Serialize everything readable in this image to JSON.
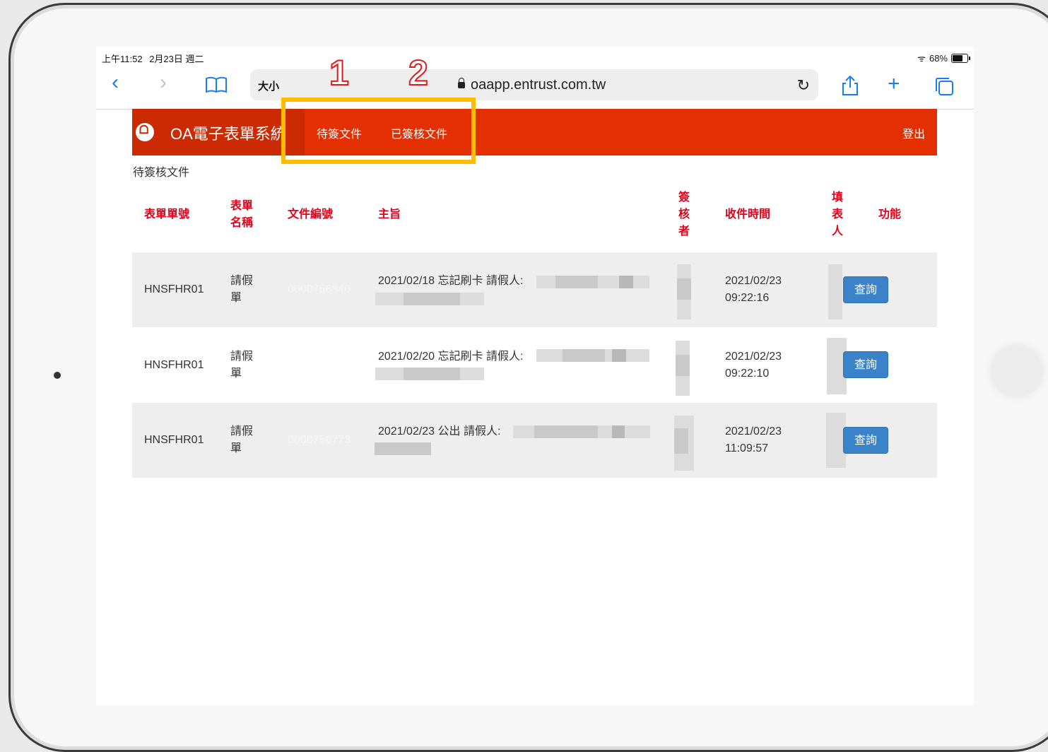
{
  "status_bar": {
    "time": "上午11:52",
    "date": "2月23日 週二",
    "battery": "68%"
  },
  "browser": {
    "text_size_label": "大小",
    "url": "oaapp.entrust.com.tw",
    "back_icon": "chevron-left-icon",
    "forward_icon": "chevron-right-icon",
    "bookmarks_icon": "book-icon",
    "reload_icon": "reload-icon",
    "share_icon": "share-icon",
    "new_tab_icon": "plus-icon",
    "tabs_icon": "tabs-icon"
  },
  "nav": {
    "brand": "OA電子表單系統",
    "pending_docs": "待簽文件",
    "signed_docs": "已簽核文件",
    "logout": "登出",
    "accent_color": "#e32f02"
  },
  "annotations": {
    "marker_1": "1",
    "marker_2": "2",
    "box_color": "#ffbc00"
  },
  "page_title": "待簽核文件",
  "table": {
    "headers": {
      "form_no": "表單單號",
      "form_name_1": "表單",
      "form_name_2": "名稱",
      "doc_no": "文件編號",
      "subject": "主旨",
      "reviewer_1": "簽",
      "reviewer_2": "核",
      "reviewer_3": "者",
      "received": "收件時間",
      "filler_1": "填",
      "filler_2": "表",
      "filler_3": "人",
      "action": "功能"
    },
    "rows": [
      {
        "form_no": "HNSFHR01",
        "form_name_1": "請假",
        "form_name_2": "單",
        "doc_no": "0000756340",
        "subject": "2021/02/18 忘記刷卡 請假人:",
        "received_date": "2021/02/23",
        "received_time": "09:22:16",
        "action": "查詢"
      },
      {
        "form_no": "HNSFHR01",
        "form_name_1": "請假",
        "form_name_2": "單",
        "doc_no": "",
        "subject": "2021/02/20 忘記刷卡 請假人:",
        "received_date": "2021/02/23",
        "received_time": "09:22:10",
        "action": "查詢"
      },
      {
        "form_no": "HNSFHR01",
        "form_name_1": "請假",
        "form_name_2": "單",
        "doc_no": "0000756773",
        "subject": "2021/02/23 公出 請假人:",
        "received_date": "2021/02/23",
        "received_time": "11:09:57",
        "action": "查詢"
      }
    ]
  }
}
